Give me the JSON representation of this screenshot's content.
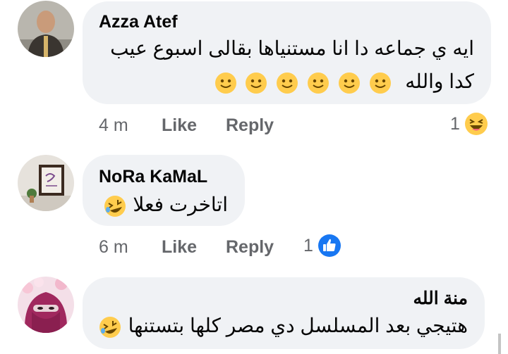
{
  "comments": [
    {
      "author": "Azza Atef",
      "text_line1": "ايه ي جماعه دا انا مستنياها بقالى اسبوع عيب",
      "text_line2": "كدا والله",
      "time": "4 m",
      "like_label": "Like",
      "reply_label": "Reply",
      "reaction_count": "1",
      "reaction_icon": "laughing-face-icon"
    },
    {
      "author": "NoRa KaMaL",
      "text": "اتاخرت فعلا",
      "time": "6 m",
      "like_label": "Like",
      "reply_label": "Reply",
      "reaction_count": "1",
      "reaction_icon": "thumbs-up-icon"
    },
    {
      "author": "منة الله",
      "text": "هتيجي بعد المسلسل دي مصر كلها بتستنها"
    }
  ],
  "colors": {
    "bubble": "#f0f2f5",
    "meta_text": "#65676b",
    "like_blue": "#1877f2",
    "emoji_yellow": "#ffcc4d"
  }
}
